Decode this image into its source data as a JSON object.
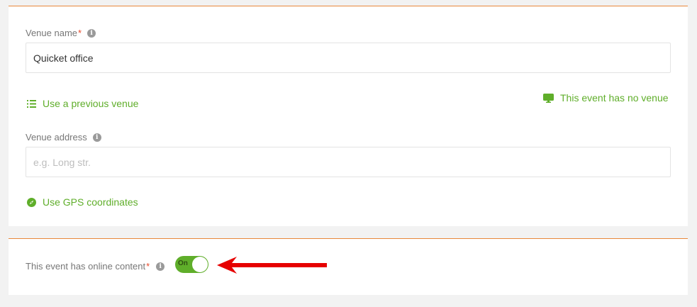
{
  "venue": {
    "name_label": "Venue name",
    "name_required_mark": "*",
    "name_value": "Quicket office",
    "use_previous_label": "Use a previous venue",
    "no_venue_label": "This event has no venue",
    "address_label": "Venue address",
    "address_placeholder": "e.g. Long str.",
    "address_value": "",
    "gps_label": "Use GPS coordinates"
  },
  "online": {
    "label": "This event has online content",
    "required_mark": "*",
    "toggle_label": "On",
    "toggle_on": true
  },
  "icons": {
    "info": "info-icon",
    "list": "list-icon",
    "monitor": "monitor-icon",
    "compass": "compass-icon",
    "arrow": "red-arrow-annotation"
  },
  "colors": {
    "accent_green": "#5fae2a",
    "divider_orange": "#e8873a",
    "required_red": "#e8492a",
    "annotation_red": "#e60000"
  }
}
